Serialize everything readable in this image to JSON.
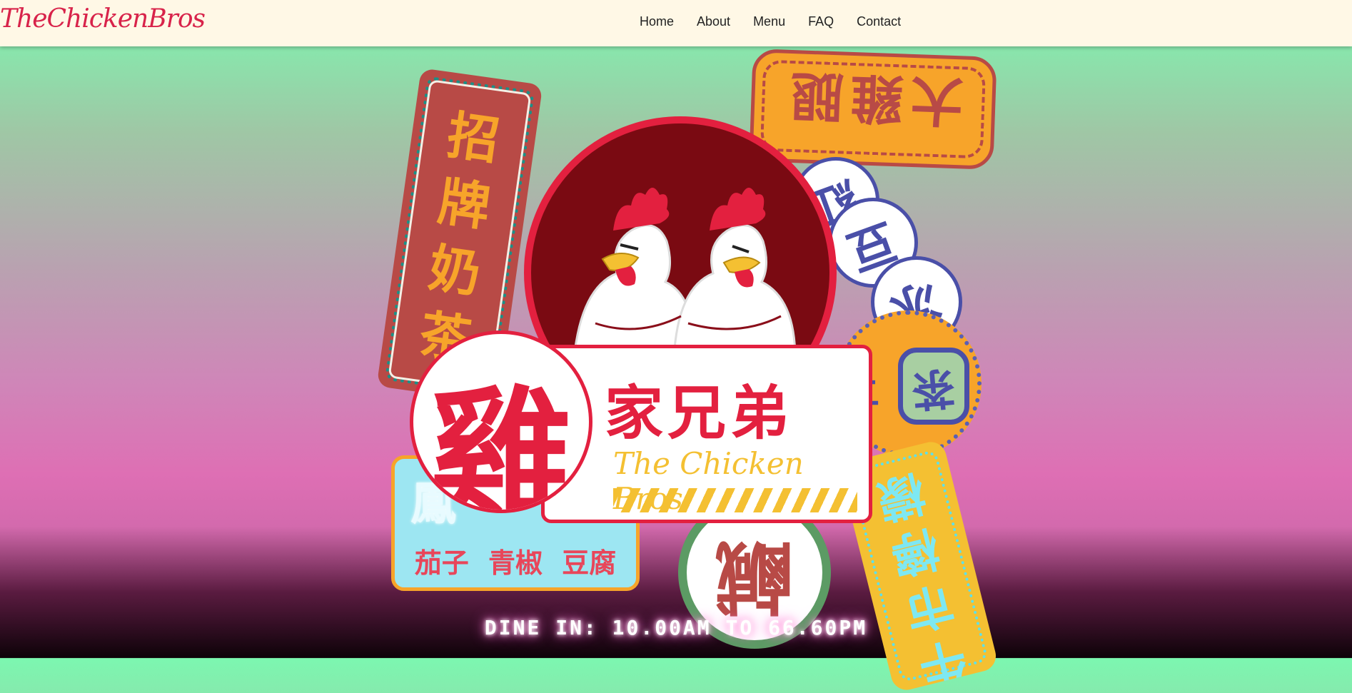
{
  "brand": {
    "name": "TheChickenBros"
  },
  "nav": {
    "items": [
      {
        "label": "Home"
      },
      {
        "label": "About"
      },
      {
        "label": "Menu"
      },
      {
        "label": "FAQ"
      },
      {
        "label": "Contact"
      }
    ]
  },
  "hero": {
    "logo": {
      "big_char": "雞",
      "chinese_name": "家兄弟",
      "english_name": "The Chicken Bros"
    },
    "signs": {
      "milk_tea": [
        "招",
        "牌",
        "奶",
        "茶"
      ],
      "drumstick": "大雞腿",
      "red_bean_ice": [
        "紅",
        "豆",
        "冰"
      ],
      "tea": "茶",
      "vegetables": "茄子 青椒 豆腐",
      "vegetables_header": "鳳",
      "bottom_circle": "鹹",
      "yellow_vertical": [
        "牛",
        "市",
        "檸",
        "檬"
      ]
    },
    "hours": "DINE IN: 10.00AM TO 66.60PM"
  },
  "colors": {
    "brand_red": "#e3203f",
    "cream": "#fff8e6",
    "orange": "#f7a42a",
    "maroon": "#7a0a12",
    "yellow": "#f4c032",
    "teal": "#1d8f86",
    "purple_blue": "#4a4fa8"
  }
}
